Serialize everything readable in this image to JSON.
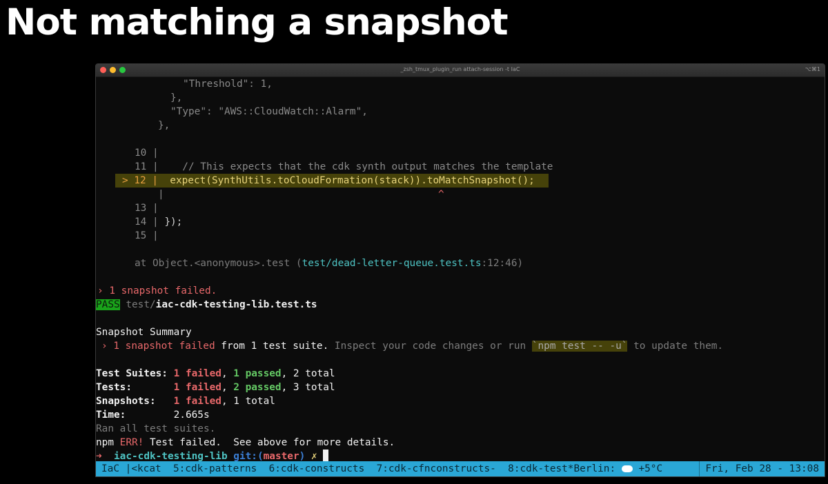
{
  "slide": {
    "title": "Not matching a snapshot"
  },
  "window": {
    "title": "_zsh_tmux_plugin_run attach-session -t IaC",
    "shortcut": "⌥⌘1"
  },
  "code": {
    "threshold": "\"Threshold\": 1,",
    "close_brace1": "},",
    "type_key": "\"Type\": ",
    "type_val": "\"AWS::CloudWatch::Alarm\",",
    "close_brace2": "},",
    "l10_num": "10 |",
    "l11_num": "11 |",
    "l11_text": "    // This expects that the cdk synth output matches the template",
    "l12_marker": "> 12 |",
    "l12_text": "  expect(SynthUtils.toCloudFormation(stack)).toMatchSnapshot();",
    "l12_sub_pipe": "|",
    "caret": "^",
    "l13_num": "13 |",
    "l14_num": "14 |",
    "l14_text": " });",
    "l15_num": "15 |"
  },
  "stack": {
    "at": "at Object.<anonymous>.test (",
    "file": "test/dead-letter-queue.test.ts",
    "pos": ":12:46)"
  },
  "results": {
    "snapshot_failed_line": "› 1 snapshot failed.",
    "pass_label": "PASS",
    "pass_dir": "test/",
    "pass_file": "iac-cdk-testing-lib.test.ts",
    "summary_header": "Snapshot Summary",
    "summary_fail": "› 1 snapshot failed",
    "summary_from": " from 1 test suite.",
    "summary_inspect": " Inspect your code changes or run ",
    "summary_cmd": "`npm test -- -u`",
    "summary_update": " to update them.",
    "suites_label": "Test Suites: ",
    "suites_failed": "1 failed",
    "suites_passed": "1 passed",
    "suites_total": "2 total",
    "tests_label": "Tests:       ",
    "tests_failed": "1 failed",
    "tests_passed": "2 passed",
    "tests_total": "3 total",
    "snapshots_label": "Snapshots:   ",
    "snapshots_failed": "1 failed",
    "snapshots_total": "1 total",
    "time_label": "Time:        ",
    "time_value": "2.665s",
    "ran_all": "Ran all test suites.",
    "npm": "npm ",
    "err": "ERR!",
    "err_msg": " Test failed.  See above for more details."
  },
  "prompt": {
    "arrow": "➜",
    "dir": "iac-cdk-testing-lib",
    "git_label": "git:(",
    "branch": "master",
    "git_close": ")",
    "dirty": "✗"
  },
  "statusbar": {
    "session": "IaC",
    "windows": [
      "<kcat",
      "5:cdk-patterns",
      "6:cdk-constructs",
      "7:cdk-cfnconstructs-",
      "8:cdk-test*"
    ],
    "weather_city": "Berlin:",
    "weather_temp": "+5°C",
    "datetime": "Fri, Feb 28 - 13:08"
  },
  "colors": {
    "statusbar_bg": "#2aa7d6",
    "highlight_bg": "#46420a",
    "pass_bg": "#19a31a",
    "error_red": "#e8686a",
    "success_green": "#64c864",
    "link_cyan": "#4ec3c3"
  }
}
